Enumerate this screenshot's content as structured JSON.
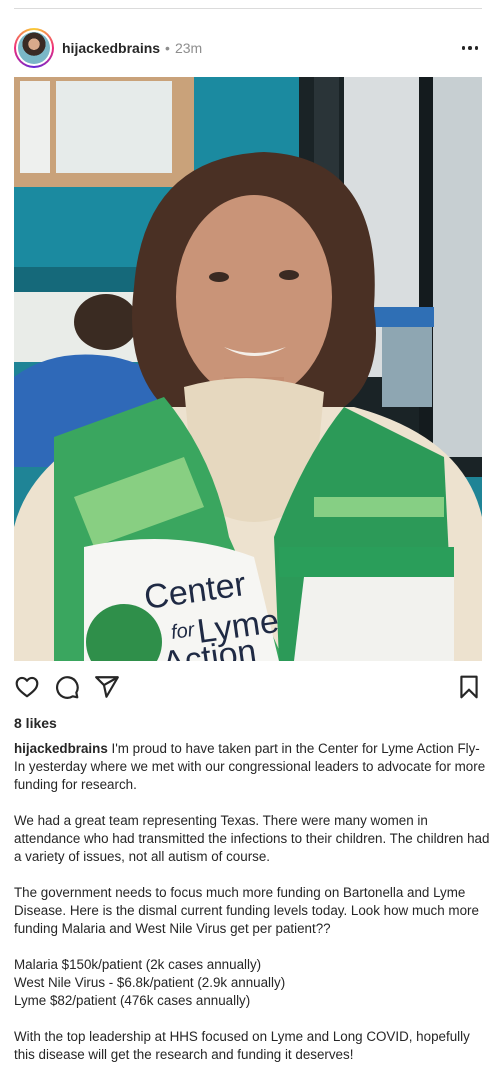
{
  "post": {
    "username": "hijackedbrains",
    "separator": "•",
    "time": "23m",
    "likes": "8 likes",
    "caption": {
      "username": "hijackedbrains",
      "p1": "I'm proud to have taken part in the Center for Lyme Action Fly-In yesterday where we met with our congressional leaders to advocate for more funding for research.",
      "p2": "We had a great team representing Texas. There were many women in attendance who had transmitted the infections to their children. The children had a variety of issues, not all autism of course.",
      "p3": "The government needs to focus much more funding on Bartonella and Lyme Disease. Here is the dismal current funding levels today. Look how much more funding Malaria and West Nile Virus get per patient??",
      "stats": [
        "Malaria $150k/patient (2k cases annually)",
        "West Nile Virus - $6.8k/patient (2.9k annually)",
        "Lyme $82/patient (476k cases annually)"
      ],
      "p4": "With the top leadership at HHS focused on Lyme and Long COVID, hopefully this disease will get the research and funding it deserves!"
    },
    "photo": {
      "vest_text": [
        "Center",
        "for",
        "Lyme",
        "Action"
      ]
    }
  },
  "icons": {
    "more": "more-options-icon",
    "like": "heart-icon",
    "comment": "comment-icon",
    "share": "share-icon",
    "save": "bookmark-icon"
  },
  "colors": {
    "wall_teal": "#1e7f91",
    "vest_green": "#2e9a57",
    "vest_light_green": "#7ec77a",
    "sweater_cream": "#efe4d2"
  }
}
